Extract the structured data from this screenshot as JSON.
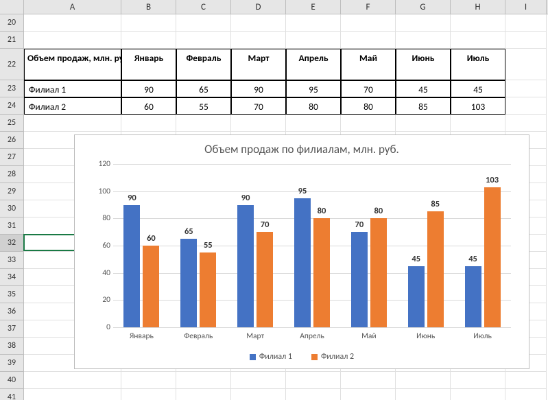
{
  "columns": [
    "A",
    "B",
    "C",
    "D",
    "E",
    "F",
    "G",
    "H",
    "I"
  ],
  "row_start": 20,
  "row_end": 41,
  "selected_row": 32,
  "table": {
    "header_label": "Объем продаж, млн. руб.",
    "months": [
      "Январь",
      "Февраль",
      "Март",
      "Апрель",
      "Май",
      "Июнь",
      "Июль"
    ],
    "rows": [
      {
        "name": "Филиал 1",
        "values": [
          90,
          65,
          90,
          95,
          70,
          45,
          45
        ]
      },
      {
        "name": "Филиал 2",
        "values": [
          60,
          55,
          70,
          80,
          80,
          85,
          103
        ]
      }
    ]
  },
  "chart_data": {
    "type": "bar",
    "title": "Объем продаж по филиалам, млн. руб.",
    "categories": [
      "Январь",
      "Февраль",
      "Март",
      "Апрель",
      "Май",
      "Июнь",
      "Июль"
    ],
    "series": [
      {
        "name": "Филиал 1",
        "values": [
          90,
          65,
          90,
          95,
          70,
          45,
          45
        ],
        "color": "#4472C4"
      },
      {
        "name": "Филиал 2",
        "values": [
          60,
          55,
          70,
          80,
          80,
          85,
          103
        ],
        "color": "#ED7D31"
      }
    ],
    "xlabel": "",
    "ylabel": "",
    "ylim": [
      0,
      120
    ],
    "y_ticks": [
      0,
      20,
      40,
      60,
      80,
      100,
      120
    ],
    "grid": true,
    "legend_position": "bottom"
  }
}
